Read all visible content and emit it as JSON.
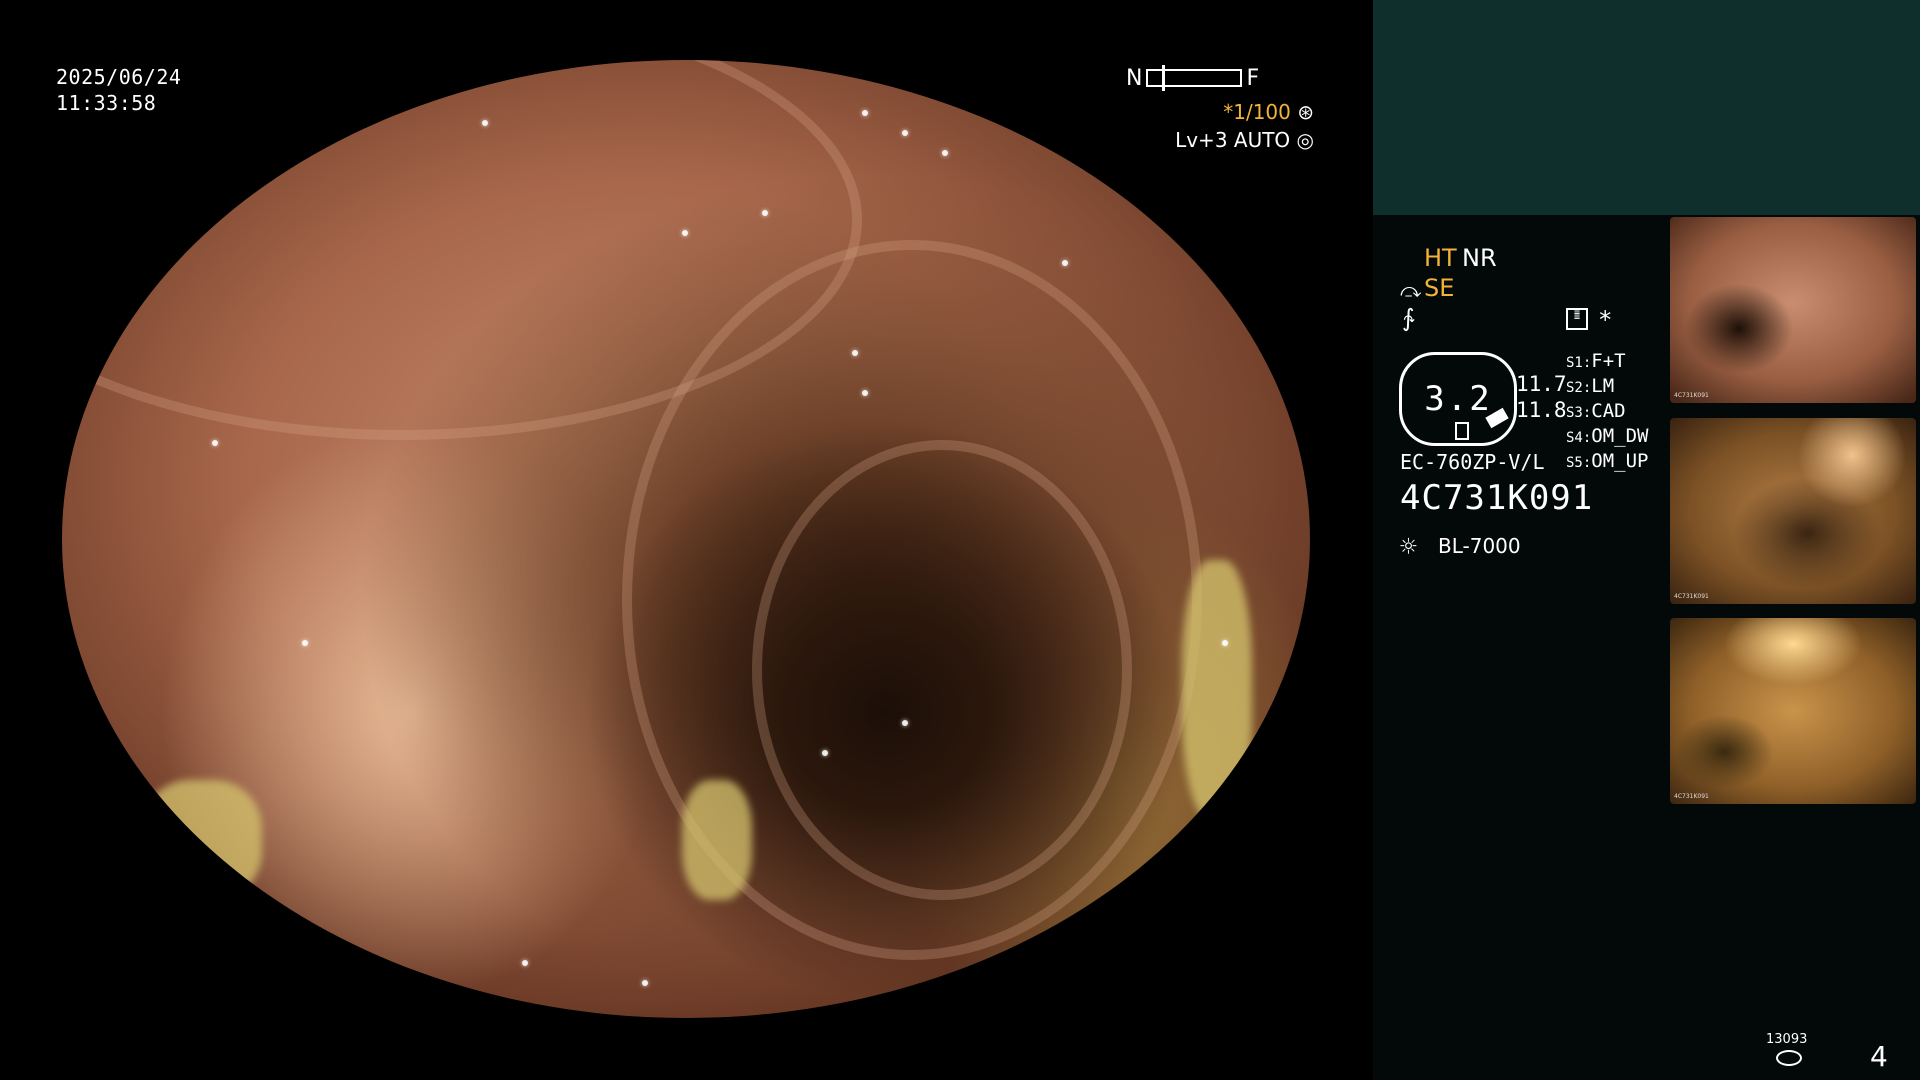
{
  "overlay": {
    "date": "2025/06/24",
    "time": "11:33:58",
    "nf_left": "N",
    "nf_right": "F",
    "shutter": "*1/100",
    "shutter_icon": "aperture-icon",
    "level": "Lv+3 AUTO",
    "level_icon": "iris-icon"
  },
  "panel": {
    "ht": "HT",
    "nr": "NR",
    "se": "SE",
    "octagon_value": "3.2",
    "num1": "11.7",
    "num2": "11.8",
    "scope_model": "EC-760ZP-V/L",
    "serial": "4C731K091",
    "light_source": "BL-7000",
    "star": "*",
    "s_items": [
      {
        "key": "S1:",
        "value": "F+T"
      },
      {
        "key": "S2:",
        "value": "LM"
      },
      {
        "key": "S3:",
        "value": "CAD"
      },
      {
        "key": "S4:",
        "value": "OM_DW"
      },
      {
        "key": "S5:",
        "value": "OM_UP"
      }
    ],
    "colors": {
      "accent": "#f2b33a",
      "panel_top": "#0e2f2c",
      "panel_bottom": "#020908"
    }
  },
  "footer": {
    "image_count": "13093",
    "page": "4"
  },
  "thumbnails": [
    {
      "caption_serial": "4C731K091"
    },
    {
      "caption_serial": "4C731K091"
    },
    {
      "caption_serial": "4C731K091"
    }
  ]
}
